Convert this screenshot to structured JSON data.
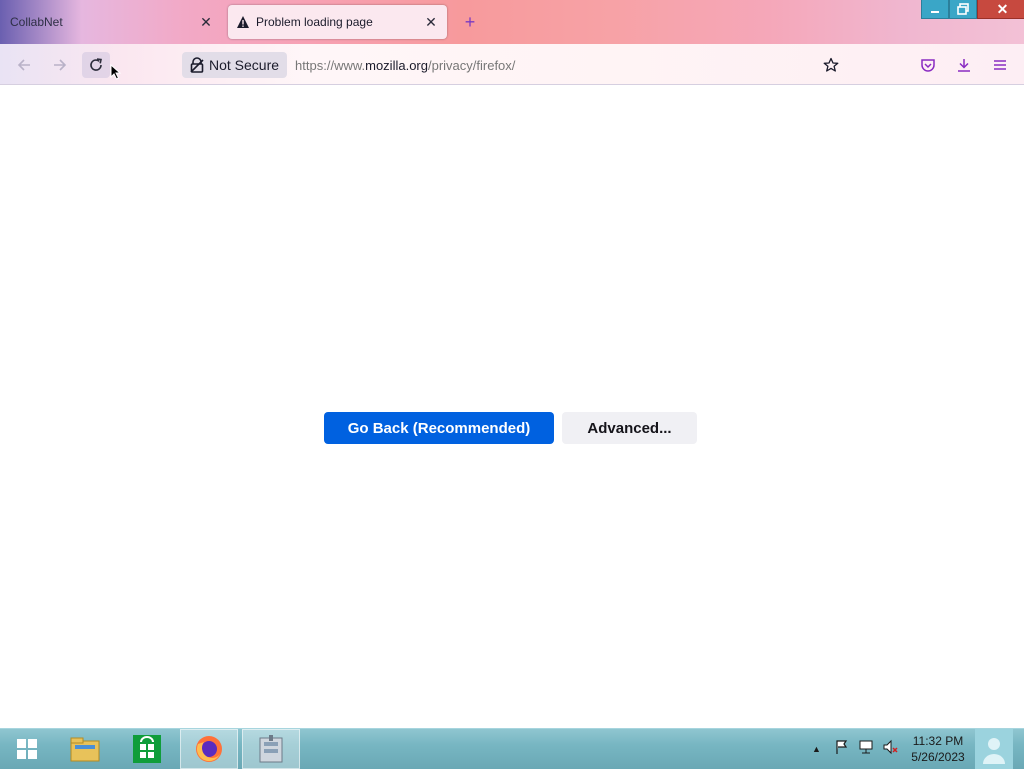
{
  "browser": {
    "tabs": [
      {
        "title": "CollabNet",
        "close": "✕"
      },
      {
        "title": "Problem loading page",
        "close": "✕"
      }
    ],
    "new_tab": "+",
    "window_controls": {
      "close": "✕"
    },
    "nav": {
      "security_label": "Not Secure",
      "url_prefix": "https://www.",
      "url_host": "mozilla.org",
      "url_path": "/privacy/firefox/"
    }
  },
  "page": {
    "go_back_label": "Go Back (Recommended)",
    "advanced_label": "Advanced..."
  },
  "taskbar": {
    "time": "11:32 PM",
    "date": "5/26/2023"
  },
  "colors": {
    "primary_button": "#0061e0",
    "secondary_button": "#f0f0f4",
    "window_close": "#c7493f"
  },
  "icons": [
    "warning-icon",
    "back-arrow-icon",
    "forward-arrow-icon",
    "reload-icon",
    "lock-warning-icon",
    "bookmark-star-icon",
    "pocket-icon",
    "download-icon",
    "menu-icon",
    "windows-start-icon",
    "file-explorer-icon",
    "store-icon",
    "firefox-icon",
    "archive-app-icon",
    "flag-icon",
    "network-icon",
    "speaker-muted-icon",
    "user-icon"
  ]
}
